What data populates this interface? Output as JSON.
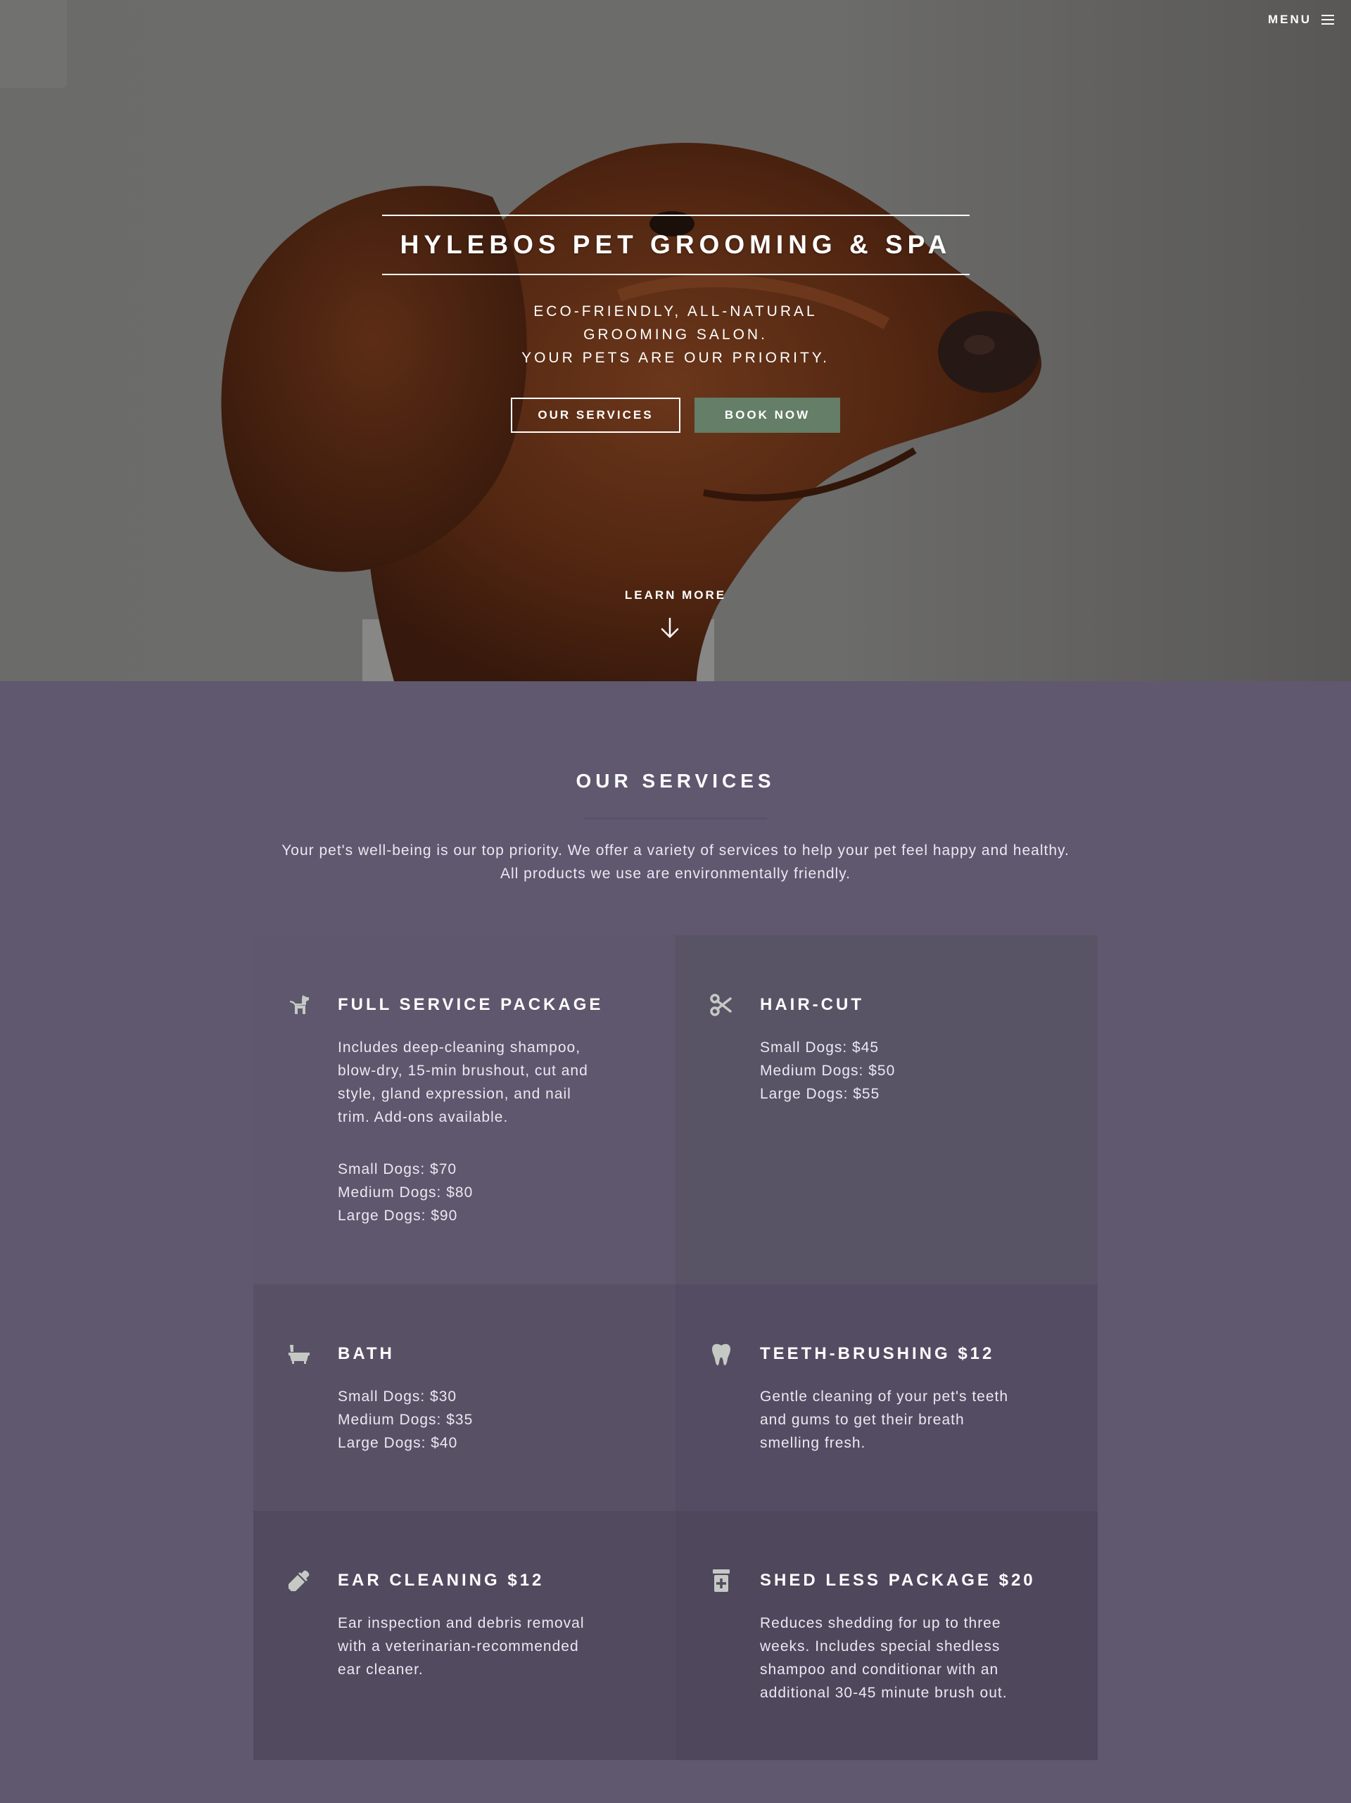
{
  "nav": {
    "menu_label": "MENU",
    "menu_icon": "hamburger-icon"
  },
  "hero": {
    "title": "HYLEBOS PET GROOMING & SPA",
    "subtitle_lines": [
      "ECO-FRIENDLY, ALL-NATURAL",
      "GROOMING SALON.",
      "YOUR PETS ARE OUR PRIORITY."
    ],
    "services_button": "OUR SERVICES",
    "book_button": "BOOK NOW",
    "learn_more": "LEARN MORE",
    "arrow_icon": "arrow-down-icon"
  },
  "services": {
    "heading": "OUR SERVICES",
    "intro_lines": [
      "Your pet's well-being is our top priority. We offer a variety of services to help your pet feel happy and healthy.",
      "All products we use are environmentally friendly."
    ],
    "items": [
      {
        "icon": "dog-icon",
        "title": "FULL SERVICE PACKAGE",
        "description_lines": [
          "Includes deep-cleaning shampoo,",
          "blow-dry, 15-min brushout, cut and",
          "style, gland expression, and nail",
          "trim. Add-ons available."
        ],
        "prices": [
          "Small Dogs: $70",
          "Medium Dogs: $80",
          "Large Dogs: $90"
        ]
      },
      {
        "icon": "scissors-icon",
        "title": "HAIR-CUT",
        "description_lines": [],
        "prices": [
          "Small Dogs: $45",
          "Medium Dogs: $50",
          "Large Dogs: $55"
        ]
      },
      {
        "icon": "bathtub-icon",
        "title": "BATH",
        "description_lines": [],
        "prices": [
          "Small Dogs: $30",
          "Medium Dogs: $35",
          "Large Dogs: $40"
        ]
      },
      {
        "icon": "tooth-icon",
        "title": "TEETH-BRUSHING $12",
        "description_lines": [
          "Gentle cleaning of your pet's teeth",
          "and gums to get their breath",
          "smelling fresh."
        ],
        "prices": []
      },
      {
        "icon": "eyedropper-icon",
        "title": "EAR CLEANING $12",
        "description_lines": [
          "Ear inspection and debris removal",
          "with a veterinarian-recommended",
          "ear cleaner."
        ],
        "prices": []
      },
      {
        "icon": "medicine-bottle-icon",
        "title": "SHED LESS PACKAGE $20",
        "description_lines": [
          "Reduces shedding for up to three",
          "weeks. Includes special shedless",
          "shampoo and conditionar with an",
          "additional 30-45 minute brush out."
        ],
        "prices": []
      }
    ]
  },
  "colors": {
    "page_background": "#5f586f",
    "accent_green": "#647e67",
    "icon_gray": "#c5c9c4",
    "text_light": "#ebe8f1"
  }
}
